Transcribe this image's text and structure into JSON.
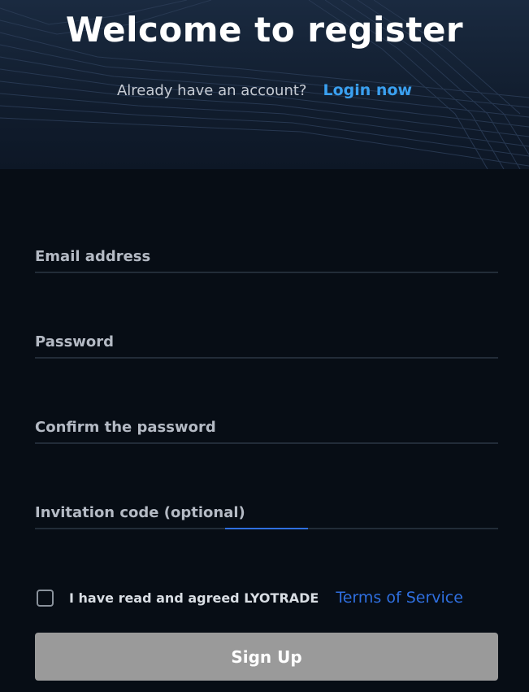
{
  "header": {
    "title": "Welcome to register",
    "already_text": "Already have an account?",
    "login_link": "Login now"
  },
  "form": {
    "fields": [
      {
        "label": "Email address"
      },
      {
        "label": "Password"
      },
      {
        "label": "Confirm the password"
      },
      {
        "label": "Invitation code (optional)"
      }
    ],
    "agree_text": "I have read and agreed LYOTRADE",
    "terms_link": "Terms of Service",
    "submit_label": "Sign Up",
    "checkbox_checked": false
  },
  "colors": {
    "background": "#070d15",
    "link": "#3aa0f0",
    "terms_link": "#2f6fe0",
    "button_disabled": "#9a9a9a",
    "focus_line": "#2f6fe0"
  }
}
